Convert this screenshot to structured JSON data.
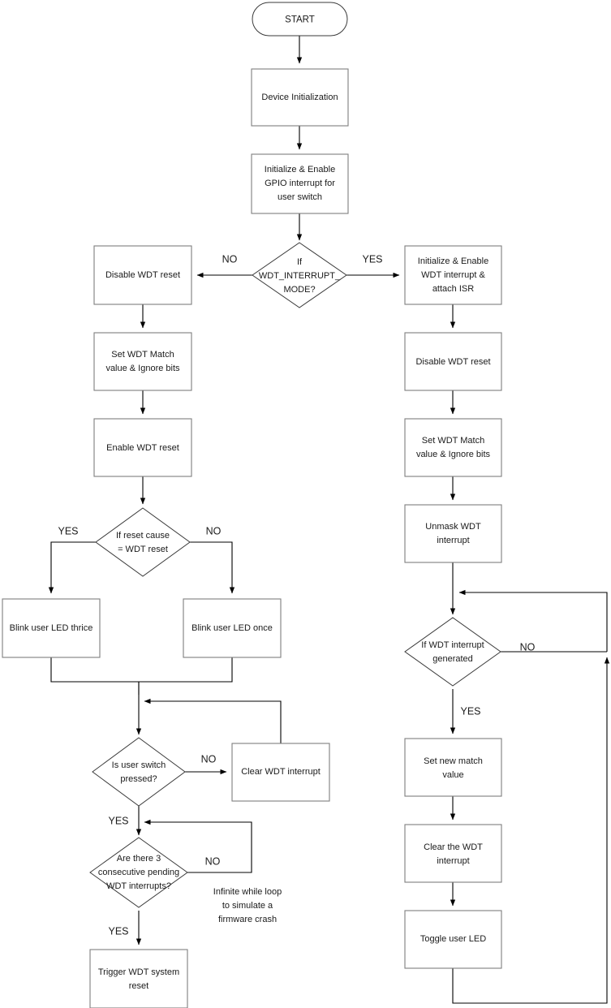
{
  "diagram": {
    "title": "WDT firmware flowchart",
    "colors": {
      "background": "#ffffff",
      "box_stroke": "#7f7f7f",
      "diamond_stroke": "#3a3a3a",
      "connector": "#7f7f7f",
      "text": "#1a1a1a"
    },
    "nodes": {
      "start": {
        "label": "START",
        "shape": "terminator"
      },
      "device_init": {
        "label": "Device Initialization",
        "shape": "process"
      },
      "gpio_init": {
        "label_line1": "Initialize & Enable",
        "label_line2": "GPIO interrupt for",
        "label_line3": "user switch",
        "shape": "process"
      },
      "mode_decision": {
        "label_line1": "If",
        "label_line2": "WDT_INTERRUPT_",
        "label_line3": "MODE?",
        "shape": "decision"
      },
      "disable_wdt_left": {
        "label": "Disable WDT reset",
        "shape": "process"
      },
      "set_match_left": {
        "label_line1": "Set WDT Match",
        "label_line2": "value & Ignore bits",
        "shape": "process"
      },
      "enable_wdt_reset": {
        "label": "Enable WDT reset",
        "shape": "process"
      },
      "reset_cause_decision": {
        "label_line1": "If reset cause",
        "label_line2": "= WDT reset",
        "shape": "decision"
      },
      "blink_thrice": {
        "label": "Blink user LED thrice",
        "shape": "process"
      },
      "blink_once": {
        "label": "Blink user LED once",
        "shape": "process"
      },
      "switch_decision": {
        "label_line1": "Is user switch",
        "label_line2": "pressed?",
        "shape": "decision"
      },
      "clear_wdt_interrupt_left": {
        "label": "Clear WDT interrupt",
        "shape": "process"
      },
      "three_pending_decision": {
        "label_line1": "Are there 3",
        "label_line2": "consecutive pending",
        "label_line3": "WDT interrupts?",
        "shape": "decision"
      },
      "crash_note": {
        "label_line1": "Infinite while loop",
        "label_line2": "to simulate a",
        "label_line3": "firmware crash",
        "shape": "annotation"
      },
      "trigger_reset": {
        "label_line1": "Trigger WDT system",
        "label_line2": "reset",
        "shape": "process"
      },
      "init_wdt_isr": {
        "label_line1": "Initialize & Enable",
        "label_line2": "WDT interrupt &",
        "label_line3": "attach ISR",
        "shape": "process"
      },
      "disable_wdt_right": {
        "label": "Disable WDT reset",
        "shape": "process"
      },
      "set_match_right": {
        "label_line1": "Set WDT Match",
        "label_line2": "value & Ignore bits",
        "shape": "process"
      },
      "unmask_wdt": {
        "label_line1": "Unmask WDT",
        "label_line2": "interrupt",
        "shape": "process"
      },
      "wdt_int_decision": {
        "label_line1": "If WDT interrupt",
        "label_line2": "generated",
        "shape": "decision"
      },
      "set_new_match": {
        "label_line1": "Set new match",
        "label_line2": "value",
        "shape": "process"
      },
      "clear_wdt_right": {
        "label_line1": "Clear the WDT",
        "label_line2": "interrupt",
        "shape": "process"
      },
      "toggle_led": {
        "label": "Toggle user LED",
        "shape": "process"
      }
    },
    "edge_labels": {
      "mode_no": "NO",
      "mode_yes": "YES",
      "reset_cause_yes": "YES",
      "reset_cause_no": "NO",
      "switch_no": "NO",
      "switch_yes": "YES",
      "pending_no": "NO",
      "pending_yes": "YES",
      "wdt_int_no": "NO",
      "wdt_int_yes": "YES"
    }
  }
}
